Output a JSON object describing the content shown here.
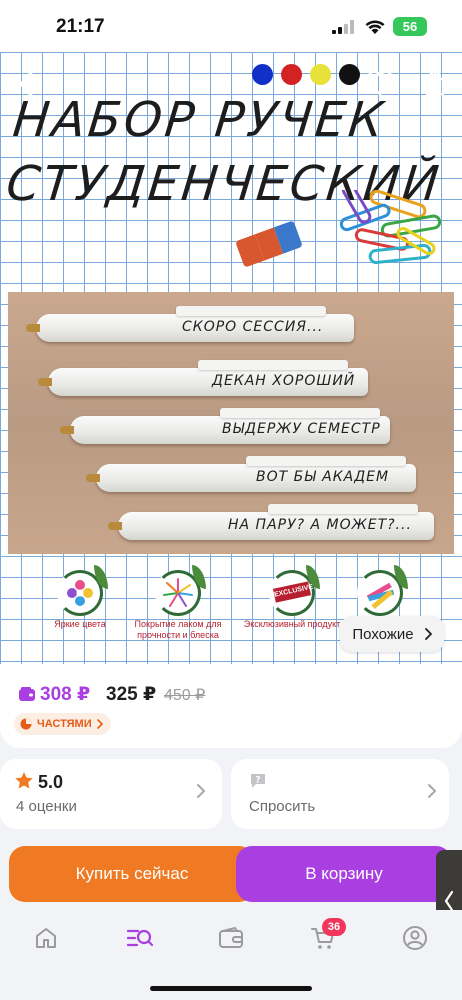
{
  "status_bar": {
    "time": "21:17",
    "battery": "56"
  },
  "product_image": {
    "title_line1": "НАБОР РУЧЕК",
    "title_line2": "СТУДЕНЧЕСКИЙ",
    "color_dots": [
      "#1230c8",
      "#d32222",
      "#e8e13a",
      "#111111"
    ],
    "pen_labels": [
      "СКОРО СЕССИЯ...",
      "ДЕКАН ХОРОШИЙ",
      "ВЫДЕРЖУ СЕМЕСТР",
      "ВОТ БЫ АКАДЕМ",
      "НА ПАРУ? А МОЖЕТ?..."
    ],
    "features": [
      {
        "label": "Яркие цвета",
        "icon": "flower-icon"
      },
      {
        "label": "Покрытие лаком для прочности и блеска",
        "icon": "burst-icon"
      },
      {
        "label": "Эксклюзивный продукт",
        "icon": "exclusive-badge-icon"
      },
      {
        "label": "",
        "icon": "colorful-pens-icon"
      }
    ],
    "exclusive_text": "EXCLUSIVE",
    "similar_label": "Похожие"
  },
  "price": {
    "main": "308 ₽",
    "alt": "325 ₽",
    "old": "450 ₽",
    "installments_label": "ЧАСТЯМИ"
  },
  "rating": {
    "score": "5.0",
    "count_label": "4 оценки"
  },
  "ask": {
    "label": "Спросить"
  },
  "actions": {
    "buy_now": "Купить сейчас",
    "add_to_cart": "В корзину"
  },
  "nav": {
    "items": [
      "home-icon",
      "catalog-search-icon",
      "wallet-icon",
      "cart-icon",
      "profile-icon"
    ],
    "cart_badge": "36"
  },
  "colors": {
    "accent": "#a93fe0",
    "orange": "#f07a23",
    "purple_button": "#a93fe0",
    "badge": "#f2355b"
  }
}
